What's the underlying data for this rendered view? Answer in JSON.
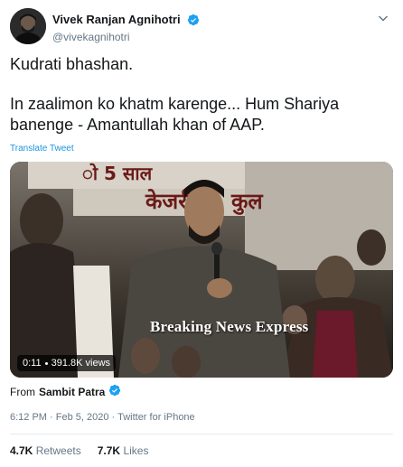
{
  "author": {
    "display_name": "Vivek Ranjan Agnihotri",
    "handle": "@vivekagnihotri",
    "verified": true
  },
  "tweet": {
    "line1": "Kudrati bhashan.",
    "line2": "In zaalimon ko khatm karenge... Hum Shariya banenge - Amantullah khan of AAP.",
    "translate_label": "Translate Tweet"
  },
  "video": {
    "duration": "0:11",
    "views": "391.8K views",
    "watermark": "Breaking News Express",
    "banner_text_1": "ो 5 साल",
    "banner_text_2": "केजरी",
    "banner_text_3": "कुल"
  },
  "source": {
    "from_label": "From",
    "from_name": "Sambit Patra",
    "verified": true
  },
  "meta": {
    "time": "6:12 PM",
    "date": "Feb 5, 2020",
    "client": "Twitter for iPhone",
    "separator": "·"
  },
  "stats": {
    "retweets_count": "4.7K",
    "retweets_label": "Retweets",
    "likes_count": "7.7K",
    "likes_label": "Likes"
  },
  "colors": {
    "link_blue": "#1b95e0",
    "verified_blue": "#1da1f2",
    "muted": "#657786",
    "text": "#14171a"
  }
}
